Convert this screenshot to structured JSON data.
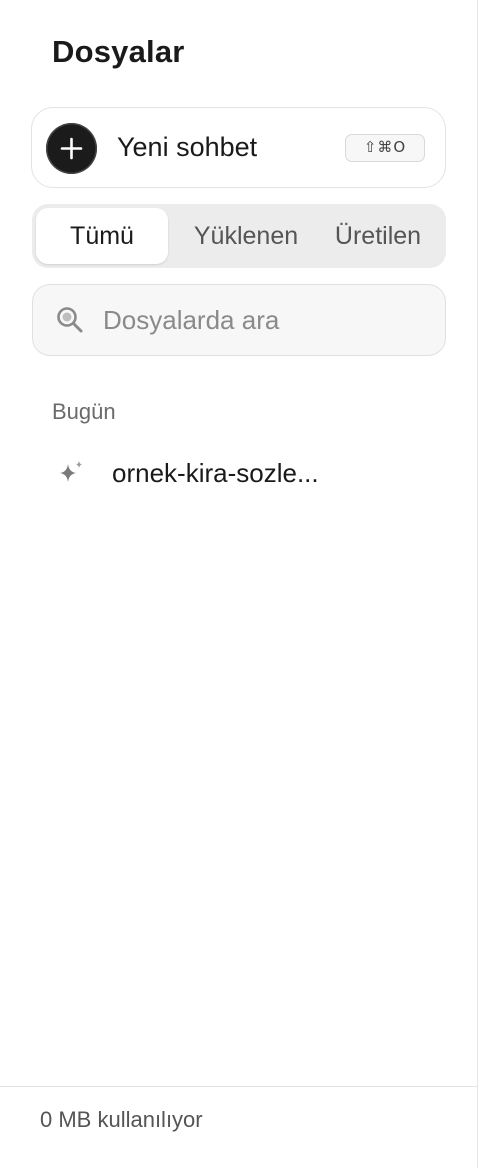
{
  "panel": {
    "title": "Dosyalar"
  },
  "new_chat": {
    "label": "Yeni sohbet",
    "shortcut": "⇧⌘O",
    "icon": "plus-icon"
  },
  "tabs": [
    {
      "label": "Tümü",
      "active": true
    },
    {
      "label": "Yüklenen",
      "active": false
    },
    {
      "label": "Üretilen",
      "active": false
    }
  ],
  "search": {
    "placeholder": "Dosyalarda ara",
    "value": "",
    "icon": "search-icon"
  },
  "files": {
    "sections": [
      {
        "label": "Bugün",
        "items": [
          {
            "name": "ornek-kira-sozle...",
            "icon": "sparkle-icon"
          }
        ]
      }
    ]
  },
  "footer": {
    "usage": "0 MB kullanılıyor"
  },
  "colors": {
    "accent": "#1b1b1b",
    "tab_track": "#ececec",
    "muted_text": "#6b6b6b"
  }
}
